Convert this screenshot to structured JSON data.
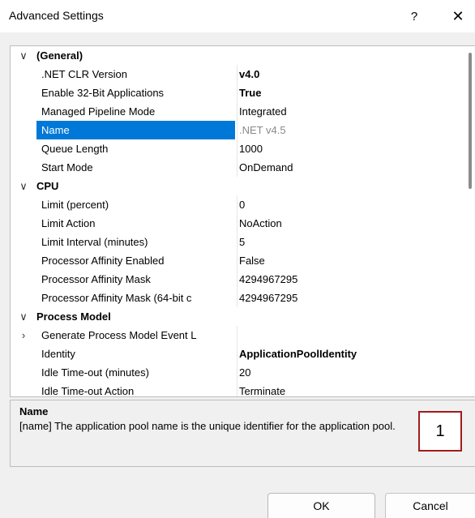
{
  "window": {
    "title": "Advanced Settings",
    "help_glyph": "?",
    "close_glyph": "✕"
  },
  "grid": {
    "rows": [
      {
        "kind": "category",
        "expander": "expanded",
        "name": "(General)"
      },
      {
        "kind": "prop",
        "name": ".NET CLR Version",
        "value": "v4.0",
        "style": "bold"
      },
      {
        "kind": "prop",
        "name": "Enable 32-Bit Applications",
        "value": "True",
        "style": "bold"
      },
      {
        "kind": "prop",
        "name": "Managed Pipeline Mode",
        "value": "Integrated",
        "style": "normal"
      },
      {
        "kind": "prop",
        "name": "Name",
        "value": ".NET v4.5",
        "style": "dim",
        "selected": true
      },
      {
        "kind": "prop",
        "name": "Queue Length",
        "value": "1000",
        "style": "normal"
      },
      {
        "kind": "prop",
        "name": "Start Mode",
        "value": "OnDemand",
        "style": "normal"
      },
      {
        "kind": "category",
        "expander": "expanded",
        "name": "CPU"
      },
      {
        "kind": "prop",
        "name": "Limit (percent)",
        "value": "0",
        "style": "normal"
      },
      {
        "kind": "prop",
        "name": "Limit Action",
        "value": "NoAction",
        "style": "normal"
      },
      {
        "kind": "prop",
        "name": "Limit Interval (minutes)",
        "value": "5",
        "style": "normal"
      },
      {
        "kind": "prop",
        "name": "Processor Affinity Enabled",
        "value": "False",
        "style": "normal"
      },
      {
        "kind": "prop",
        "name": "Processor Affinity Mask",
        "value": "4294967295",
        "style": "normal"
      },
      {
        "kind": "prop",
        "name": "Processor Affinity Mask (64-bit c",
        "value": "4294967295",
        "style": "normal"
      },
      {
        "kind": "category",
        "expander": "expanded",
        "name": "Process Model"
      },
      {
        "kind": "prop",
        "name": "Generate Process Model Event L",
        "value": "",
        "style": "normal",
        "expander": "collapsed"
      },
      {
        "kind": "prop",
        "name": "Identity",
        "value": "ApplicationPoolIdentity",
        "style": "bold"
      },
      {
        "kind": "prop",
        "name": "Idle Time-out (minutes)",
        "value": "20",
        "style": "normal"
      },
      {
        "kind": "prop",
        "name": "Idle Time-out Action",
        "value": "Terminate",
        "style": "normal"
      }
    ]
  },
  "description": {
    "title": "Name",
    "text": "[name] The application pool name is the unique identifier for the application pool."
  },
  "annotation": {
    "label": "1",
    "border_color": "#a21c1c"
  },
  "buttons": {
    "ok_label": "OK",
    "cancel_label": "Cancel"
  },
  "colors": {
    "selection": "#0078d7"
  }
}
